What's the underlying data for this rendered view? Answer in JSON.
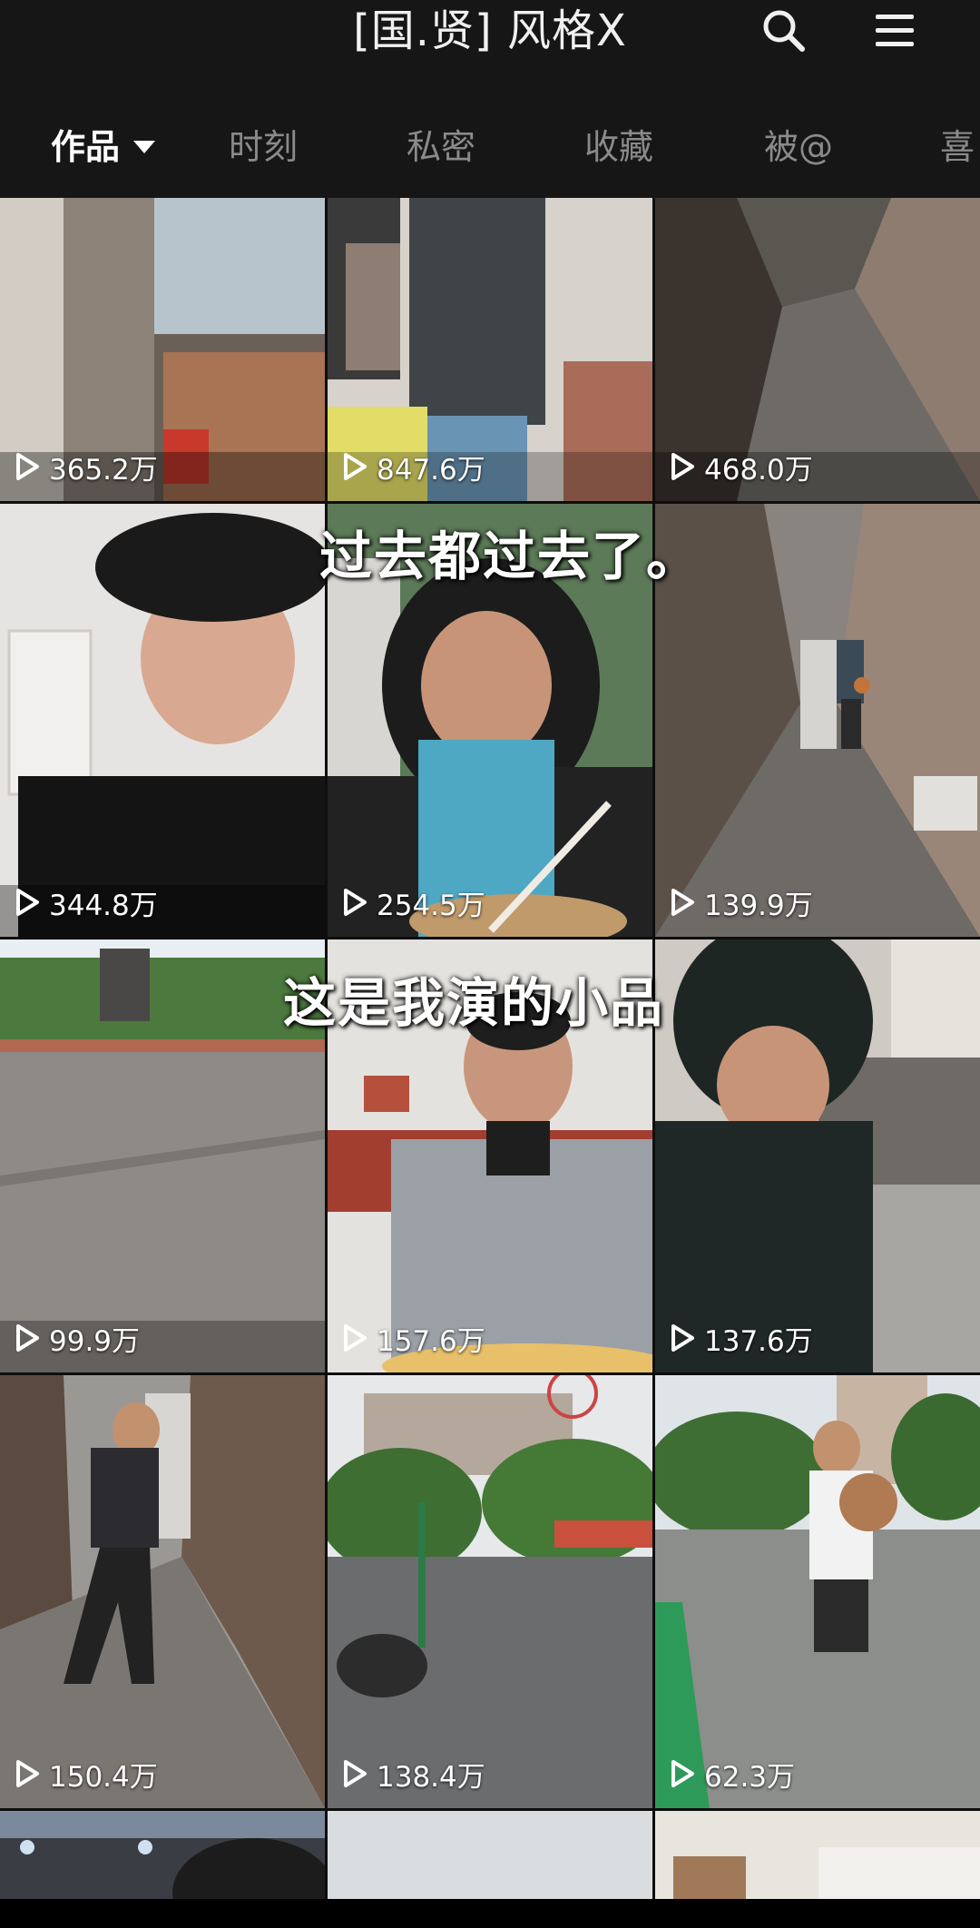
{
  "header": {
    "title": "[国.贤] 风格X",
    "search_icon": "search-icon",
    "menu_icon": "menu-icon"
  },
  "tabs": [
    {
      "label": "作品",
      "active": true
    },
    {
      "label": "时刻",
      "active": false
    },
    {
      "label": "私密",
      "active": false
    },
    {
      "label": "收藏",
      "active": false
    },
    {
      "label": "被@",
      "active": false
    },
    {
      "label": "喜",
      "active": false
    }
  ],
  "accent_color": "#f2c230",
  "captions": [
    "过去都过去了。",
    "这是我演的小品"
  ],
  "videos": [
    {
      "views": "365.2万",
      "scene": "room-interior"
    },
    {
      "views": "847.6万",
      "scene": "person-in-room"
    },
    {
      "views": "468.0万",
      "scene": "wet-alley"
    },
    {
      "views": "344.8万",
      "scene": "person-black-hat"
    },
    {
      "views": "254.5万",
      "scene": "person-hoodie-eating"
    },
    {
      "views": "139.9万",
      "scene": "alley-with-basketball-player"
    },
    {
      "views": "99.9万",
      "scene": "empty-court"
    },
    {
      "views": "157.6万",
      "scene": "person-grey-hoodie"
    },
    {
      "views": "137.6万",
      "scene": "person-hooded-street"
    },
    {
      "views": "150.4万",
      "scene": "person-walking-alley"
    },
    {
      "views": "138.4万",
      "scene": "rainy-basketball-court"
    },
    {
      "views": "62.3万",
      "scene": "person-with-basketball"
    },
    {
      "views": "",
      "scene": "indoor-partial"
    },
    {
      "views": "",
      "scene": "bright-partial"
    },
    {
      "views": "",
      "scene": "room-partial"
    }
  ]
}
